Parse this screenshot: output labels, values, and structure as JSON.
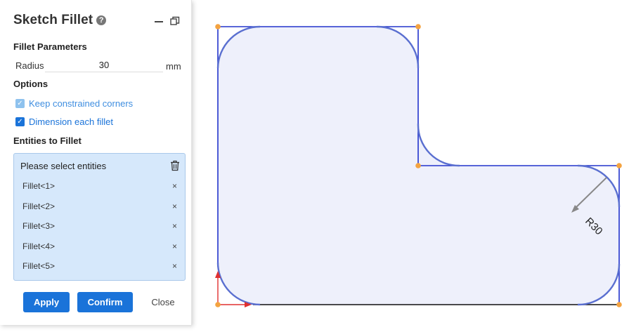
{
  "panel": {
    "title": "Sketch Fillet",
    "help_icon": "?",
    "fillet_parameters_label": "Fillet Parameters",
    "radius_label": "Radius",
    "radius_value": "30",
    "radius_unit": "mm",
    "options_label": "Options",
    "options": [
      {
        "label": "Keep constrained corners",
        "checked": true,
        "disabled": true
      },
      {
        "label": "Dimension each fillet",
        "checked": true,
        "disabled": false
      }
    ],
    "entities_label": "Entities to Fillet",
    "entities_prompt": "Please select entities",
    "entities": [
      "Fillet<1>",
      "Fillet<2>",
      "Fillet<3>",
      "Fillet<4>",
      "Fillet<5>"
    ],
    "remove_glyph": "×",
    "buttons": {
      "apply": "Apply",
      "confirm": "Confirm",
      "close": "Close"
    }
  },
  "canvas": {
    "dimension_label": "R30",
    "colors": {
      "fill": "#eef0fb",
      "line": "#2233cc",
      "fillet": "#5a6fd0",
      "point": "#f4a340",
      "axis_x": "#e03030",
      "dimension": "#888888"
    }
  }
}
